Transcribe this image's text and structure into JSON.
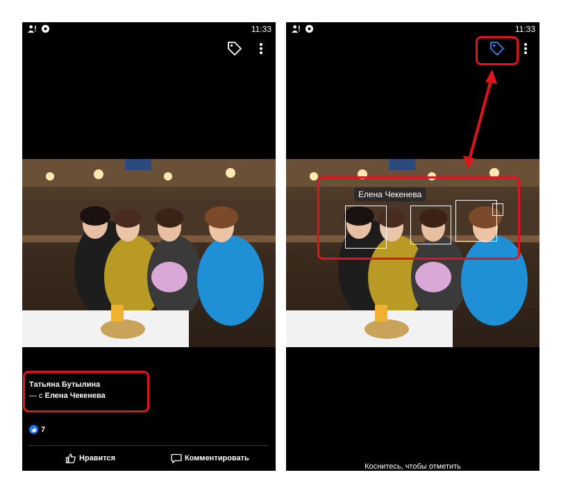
{
  "status_bar": {
    "time": "11:33"
  },
  "left_screen": {
    "post": {
      "author": "Татьяна Бутылина",
      "with_prefix": "— с",
      "tagged_name": "Елена Чекенева",
      "likes_count": "7"
    },
    "actions": {
      "like_label": "Нравится",
      "comment_label": "Комментировать"
    },
    "icons": [
      "tag-icon",
      "more-vertical-icon",
      "like-icon",
      "thumbs-up-icon",
      "comment-icon"
    ]
  },
  "right_screen": {
    "tag_label": "Елена Чекенева",
    "hint": "Коснитесь, чтобы отметить",
    "icons": [
      "tag-icon",
      "more-vertical-icon"
    ]
  },
  "colors": {
    "highlight": "#e0141b",
    "accent": "#1877f2",
    "background": "#000000"
  }
}
